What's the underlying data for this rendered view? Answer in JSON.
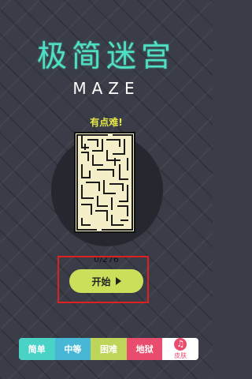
{
  "header": {
    "title": "极简迷宫",
    "subtitle": "MAZE"
  },
  "level": {
    "difficulty_label": "有点难!",
    "progress": "0/276"
  },
  "actions": {
    "start_label": "开始"
  },
  "tabs": [
    {
      "label": "简单"
    },
    {
      "label": "中等"
    },
    {
      "label": "困难"
    },
    {
      "label": "地狱"
    },
    {
      "label": "皮肤"
    }
  ],
  "colors": {
    "background": "#3a3d47",
    "title": "#4fe0c4",
    "difficulty": "#e6e84a",
    "start_button": "#cbdf5a",
    "maze_fill": "#f5efc9",
    "tab_easy": "#4bd2c6",
    "tab_medium": "#48b7d6",
    "tab_hard": "#bdd65a",
    "tab_hell": "#e84d6e"
  },
  "icons": {
    "start": "play-icon",
    "skin": "skin-icon"
  }
}
